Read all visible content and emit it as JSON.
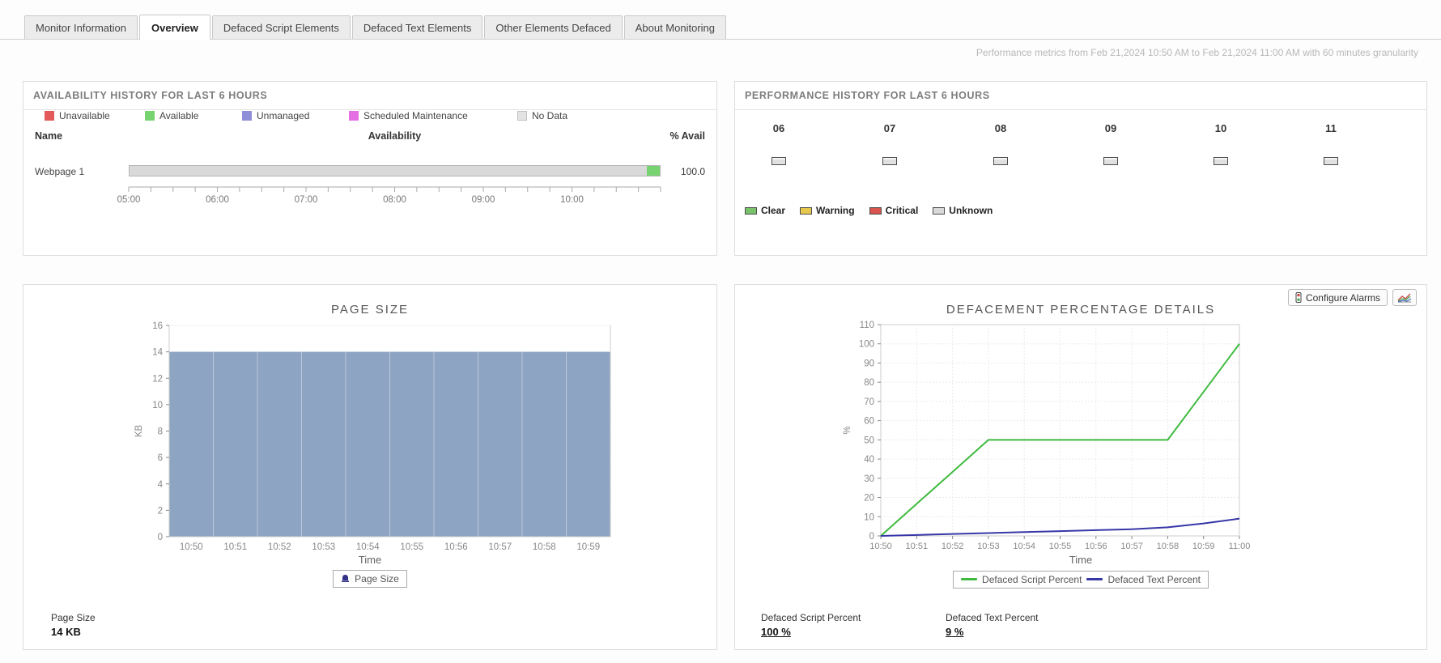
{
  "tabs": {
    "items": [
      {
        "label": "Monitor Information",
        "active": false
      },
      {
        "label": "Overview",
        "active": true
      },
      {
        "label": "Defaced Script Elements",
        "active": false
      },
      {
        "label": "Defaced Text Elements",
        "active": false
      },
      {
        "label": "Other Elements Defaced",
        "active": false
      },
      {
        "label": "About Monitoring",
        "active": false
      }
    ]
  },
  "metrics_note": "Performance metrics from Feb 21,2024 10:50 AM to Feb 21,2024 11:00 AM with 60 minutes granularity",
  "availability": {
    "header": "AVAILABILITY HISTORY FOR LAST 6 HOURS",
    "columns": {
      "name": "Name",
      "availability": "Availability",
      "percent": "% Avail"
    },
    "row": {
      "name": "Webpage 1",
      "percent": "100.0",
      "segments": [
        {
          "status": "No Data",
          "pct": 97.6,
          "color": "#d9d9d9"
        },
        {
          "status": "Available",
          "pct": 2.4,
          "color": "#77d36f"
        }
      ]
    },
    "time_labels": [
      "05:00",
      "06:00",
      "07:00",
      "08:00",
      "09:00",
      "10:00"
    ],
    "legend": [
      {
        "label": "Unavailable",
        "color": "#e25a5a"
      },
      {
        "label": "Available",
        "color": "#77d36f"
      },
      {
        "label": "Unmanaged",
        "color": "#8f8fd8"
      },
      {
        "label": "Scheduled Maintenance",
        "color": "#e36fe3"
      },
      {
        "label": "No Data",
        "color": "#e3e3e3"
      }
    ]
  },
  "performance": {
    "header": "PERFORMANCE HISTORY FOR LAST 6 HOURS",
    "hours": [
      "06",
      "07",
      "08",
      "09",
      "10",
      "11"
    ],
    "hour_status": {
      "status": "Unknown",
      "color": "#e0e0e0"
    },
    "legend": [
      {
        "label": "Clear",
        "color": "#79c36a"
      },
      {
        "label": "Warning",
        "color": "#e6c84e"
      },
      {
        "label": "Critical",
        "color": "#d9534f"
      },
      {
        "label": "Unknown",
        "color": "#d9d9d9"
      }
    ]
  },
  "toolbar": {
    "configure_alarms_label": "Configure Alarms"
  },
  "chart_data": [
    {
      "id": "page_size",
      "type": "bar",
      "title": "PAGE SIZE",
      "categories": [
        "10:50",
        "10:51",
        "10:52",
        "10:53",
        "10:54",
        "10:55",
        "10:56",
        "10:57",
        "10:58",
        "10:59"
      ],
      "values": [
        14,
        14,
        14,
        14,
        14,
        14,
        14,
        14,
        14,
        14
      ],
      "xlabel": "Time",
      "ylabel": "KB",
      "ylim": [
        0,
        16
      ],
      "ytick_step": 2,
      "bar_color": "#8da4c2",
      "grid": true,
      "legend": {
        "label": "Page Size",
        "marker_color": "#333388",
        "position": "bottom"
      }
    },
    {
      "id": "defacement_percentage",
      "type": "line",
      "title": "DEFACEMENT PERCENTAGE DETAILS",
      "x": [
        "10:50",
        "10:51",
        "10:52",
        "10:53",
        "10:54",
        "10:55",
        "10:56",
        "10:57",
        "10:58",
        "10:59",
        "11:00"
      ],
      "series": [
        {
          "name": "Defaced Script Percent",
          "color": "#3fba3f",
          "values": [
            0,
            16.7,
            33.3,
            50,
            50,
            50,
            50,
            50,
            50,
            75,
            100
          ]
        },
        {
          "name": "Defaced Text Percent",
          "color": "#3737a8",
          "values": [
            0,
            0.5,
            1,
            1.5,
            2,
            2.5,
            3,
            3.5,
            4.5,
            6.5,
            9
          ]
        }
      ],
      "xlabel": "Time",
      "ylabel": "%",
      "ylim": [
        0,
        110
      ],
      "ytick_step": 10,
      "grid": true,
      "legend_position": "bottom"
    }
  ],
  "summaries": {
    "page_size": {
      "label": "Page Size",
      "value": "14 KB"
    },
    "defaced_script": {
      "label": "Defaced Script Percent",
      "value": "100 %"
    },
    "defaced_text": {
      "label": "Defaced Text Percent",
      "value": "9 %"
    }
  }
}
